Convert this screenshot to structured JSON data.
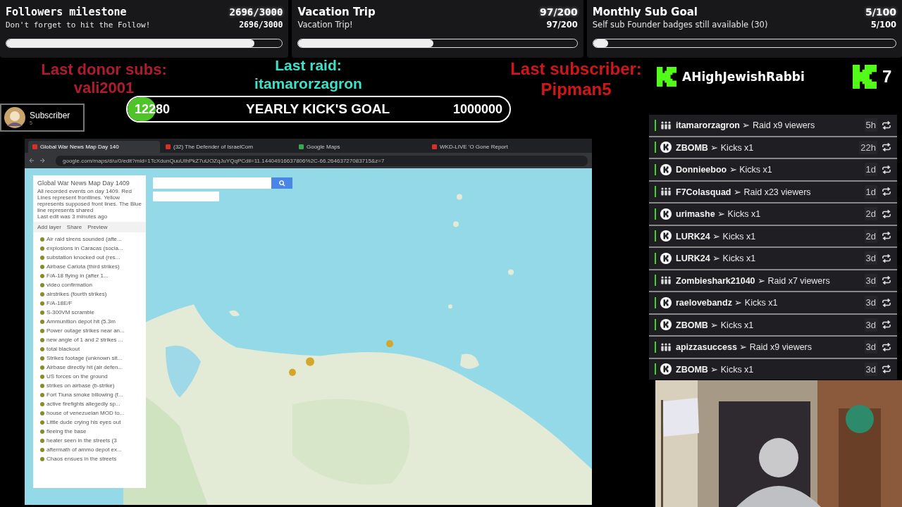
{
  "goals": [
    {
      "kind": "mono",
      "title": "Followers milestone",
      "subtitle": "Don't forget to hit the Follow!",
      "count": "2696/3000",
      "count_small": "2696/3000",
      "level": 0.9
    },
    {
      "kind": "sans",
      "title": "Vacation Trip",
      "subtitle": "Vacation Trip!",
      "count": "97/200",
      "count_small": "97/200",
      "level": 0.485
    },
    {
      "kind": "sans",
      "title": "Monthly Sub Goal",
      "subtitle": "Self sub Founder badges still available (30)",
      "count": "5/100",
      "count_small": "5/100",
      "level": 0.05
    }
  ],
  "labels": [
    {
      "heading": "Last donor subs:",
      "name": "vali2001",
      "color": "#b01c2e"
    },
    {
      "heading": "Last raid:",
      "name": "itamarorzagron",
      "color": "#3de0c8"
    },
    {
      "heading": "Last subscriber:",
      "name": "Pipman5",
      "color": "#d0161b"
    }
  ],
  "kick_goal": {
    "current": "12280",
    "title": "YEARLY KICK'S GOAL",
    "target": "1000000",
    "level": 0.0123
  },
  "subscriber_badge": {
    "label": "Subscriber",
    "count": "5"
  },
  "top_supporter": {
    "name": "AHighJewishRabbi"
  },
  "kick_count": "7",
  "events": [
    {
      "kind": "raid",
      "user": "itamarorzagron",
      "action": "➢ Raid x9 viewers",
      "time": "5h"
    },
    {
      "kind": "kick",
      "user": "ZBOMB",
      "action": "➢ Kicks x1",
      "time": "22h"
    },
    {
      "kind": "kick",
      "user": "Donnieeboo",
      "action": "➢ Kicks x1",
      "time": "1d"
    },
    {
      "kind": "raid",
      "user": "F7Colasquad",
      "action": "➢ Raid x23 viewers",
      "time": "1d"
    },
    {
      "kind": "kick",
      "user": "urimashe",
      "action": "➢ Kicks x1",
      "time": "2d"
    },
    {
      "kind": "kick",
      "user": "LURK24",
      "action": "➢ Kicks x1",
      "time": "2d"
    },
    {
      "kind": "kick",
      "user": "LURK24",
      "action": "➢ Kicks x1",
      "time": "3d"
    },
    {
      "kind": "raid",
      "user": "Zombieshark21040",
      "action": "➢ Raid x7 viewers",
      "time": "3d"
    },
    {
      "kind": "kick",
      "user": "raelovebandz",
      "action": "➢ Kicks x1",
      "time": "3d"
    },
    {
      "kind": "kick",
      "user": "ZBOMB",
      "action": "➢ Kicks x1",
      "time": "3d"
    },
    {
      "kind": "raid",
      "user": "apizzasuccess",
      "action": "➢ Raid x9 viewers",
      "time": "3d"
    },
    {
      "kind": "kick",
      "user": "ZBOMB",
      "action": "➢ Kicks x1",
      "time": "3d"
    }
  ],
  "browser": {
    "tabs": [
      {
        "title": "Global War News Map Day 140",
        "selected": true
      },
      {
        "title": "(32) The Defender of IsraelCom",
        "selected": false
      },
      {
        "title": "Google Maps",
        "selected": false
      },
      {
        "title": "WKD-LIVE 'O Gone Report",
        "selected": false
      }
    ],
    "url": "google.com/maps/d/u/0/edit?mid=1TcXdunQuuUIhPkZ7uUOZqJuYQqPCdil=11.14404916637806%2C-66.26463727083715&z=7",
    "panel": {
      "title": "Global War News Map Day 1409",
      "description": "All recorded events on day 1409. Red Lines represent frontlines. Yellow represents supposed front lines. The Blue line represents shared",
      "last_edit": "Last edit was 3 minutes ago",
      "actions": [
        "Add layer",
        "Share",
        "Preview"
      ],
      "items": [
        "Air raid sirens sounded (afte...",
        "explosions in Caracas (socia...",
        "substation knocked out (res...",
        "Airbase Carlota (third strikes)",
        "F/A-18 flying in (after 1...",
        "video confirmation",
        "airstrikes (fourth strikes)",
        "F/A-18E/F",
        "S-300VM scramble",
        "Ammunition depot hit (5.3m",
        "Power outage strikes near an...",
        "new angle of 1 and 2 strikes ...",
        "total blackout",
        "Strikes footage (unknown sit...",
        "Airbase directly hit (air defen...",
        "US forces on the ground",
        "strikes on airbase (b-strike)",
        "Fort Tiuna smoke billowing (f...",
        "active firefights allegedly sp...",
        "house of venezuelan MOD to...",
        "Little dude crying his eyes out",
        "fleeing the base",
        "heater seen in the streets (3",
        "aftermath of ammo depot ex...",
        "Chaos ensues in the streets"
      ]
    }
  }
}
